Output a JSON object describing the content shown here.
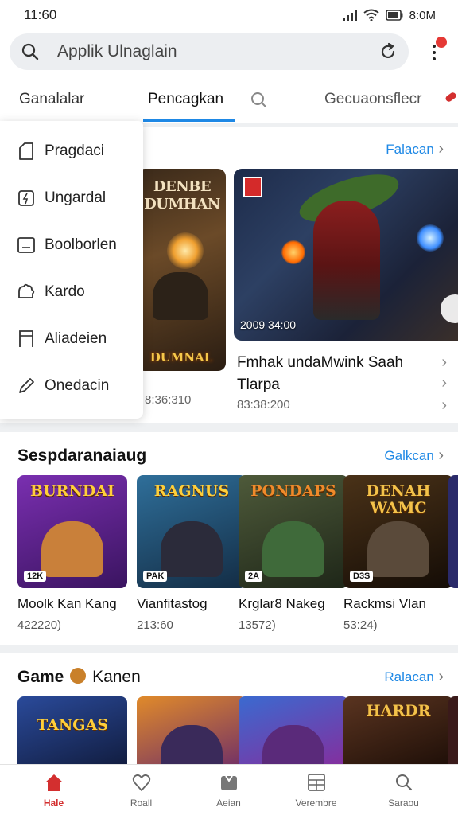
{
  "status_bar": {
    "time": "11:60",
    "right_time": "8:0M"
  },
  "search": {
    "placeholder": "Applik Ulnaglain"
  },
  "tabs": [
    {
      "label": "Ganalalar",
      "active": false
    },
    {
      "label": "Pencagkan",
      "active": true
    },
    {
      "label": "Gecuaonsflecr",
      "active": false
    }
  ],
  "dropdown": {
    "items": [
      {
        "label": "Pragdaci",
        "icon": "tag-icon"
      },
      {
        "label": "Ungardal",
        "icon": "lightning-icon"
      },
      {
        "label": "Boolborlen",
        "icon": "book-icon"
      },
      {
        "label": "Kardo",
        "icon": "puzzle-icon"
      },
      {
        "label": "Aliadeien",
        "icon": "flag-icon"
      },
      {
        "label": "Onedacin",
        "icon": "pencil-icon"
      }
    ]
  },
  "featured": {
    "see_all": "Falacan",
    "left_card": {
      "title": "DENBE DUMHAN",
      "logo": "DUMNAL",
      "date": "8:36:310"
    },
    "main_card": {
      "date": "2009 34:00",
      "title": "Fmhak undaMwink Saah Tlarpa",
      "meta": "83:38:200"
    }
  },
  "section2": {
    "title": "Sespdaranaiaug",
    "see_all": "Galkcan",
    "cards": [
      {
        "thumb_title": "BURNDAI",
        "tag": "12K",
        "name": "Moolk Kan Kang",
        "meta": "422220)",
        "bg": "#6a2a9a"
      },
      {
        "thumb_title": "RAGNUS",
        "tag": "PAK",
        "name": "Vianfitastog",
        "meta": "213:60",
        "bg": "#1f4a6b"
      },
      {
        "thumb_title": "PONDAPS",
        "tag": "2A",
        "name": "Krglar8 Nakeg",
        "meta": "13572)",
        "bg": "#3a4a2a"
      },
      {
        "thumb_title": "DENAH WAMC",
        "tag": "D3S",
        "name": "Rackmsi Vlan",
        "meta": "53:24)",
        "bg": "#3a2a18"
      }
    ]
  },
  "section3": {
    "title": "Game",
    "title_suffix": "Kanen",
    "see_all": "Ralacan",
    "cards": [
      {
        "thumb_title": "TANGAS",
        "bg": "#1f3a7a"
      },
      {
        "thumb_title": "",
        "bg": "#6a2a6a"
      },
      {
        "thumb_title": "",
        "bg": "#2a4a8a"
      },
      {
        "thumb_title": "HARDR",
        "bg": "#3a2418"
      }
    ]
  },
  "bottom_nav": [
    {
      "label": "Hale",
      "icon": "home-icon",
      "active": true
    },
    {
      "label": "Roall",
      "icon": "heart-icon",
      "active": false
    },
    {
      "label": "Aeian",
      "icon": "app-icon",
      "active": false
    },
    {
      "label": "Verembre",
      "icon": "grid-icon",
      "active": false
    },
    {
      "label": "Saraou",
      "icon": "search-icon",
      "active": false
    }
  ],
  "colors": {
    "accent": "#1e88e5",
    "active_nav": "#d32f2f"
  }
}
